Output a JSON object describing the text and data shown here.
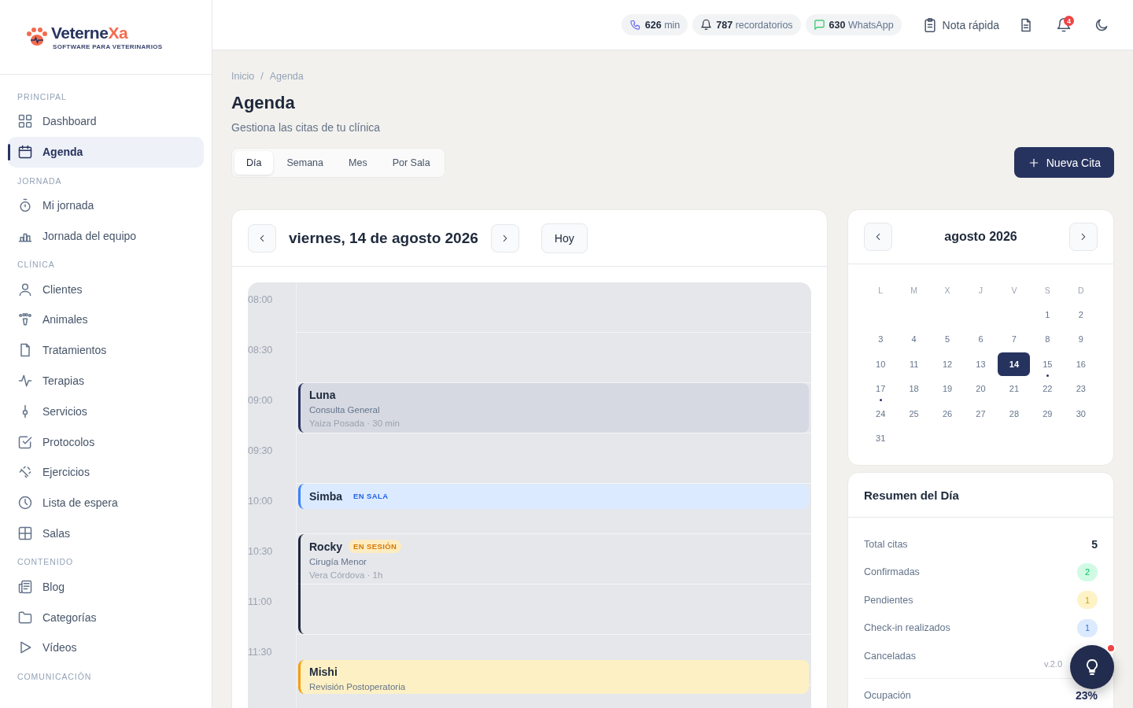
{
  "brand": {
    "name_main": "Veterne",
    "name_accent": "Xa",
    "tagline": "SOFTWARE PARA VETERINARIOS"
  },
  "topbar": {
    "chips": [
      {
        "kind": "phone",
        "value": "626",
        "label": "min"
      },
      {
        "kind": "bell",
        "value": "787",
        "label": "recordatorios"
      },
      {
        "kind": "chat",
        "value": "630",
        "label": "WhatsApp"
      }
    ],
    "quick_note": "Nota rápida",
    "notifications": "4"
  },
  "sidebar": {
    "sections": [
      {
        "title": "PRINCIPAL",
        "items": [
          {
            "label": "Dashboard",
            "selected": false
          },
          {
            "label": "Agenda",
            "selected": true
          }
        ]
      },
      {
        "title": "JORNADA",
        "items": [
          {
            "label": "Mi jornada",
            "selected": false
          },
          {
            "label": "Jornada del equipo",
            "selected": false
          }
        ]
      },
      {
        "title": "CLÍNICA",
        "items": [
          {
            "label": "Clientes",
            "selected": false
          },
          {
            "label": "Animales",
            "selected": false
          },
          {
            "label": "Tratamientos",
            "selected": false
          },
          {
            "label": "Terapias",
            "selected": false
          },
          {
            "label": "Servicios",
            "selected": false
          },
          {
            "label": "Protocolos",
            "selected": false
          },
          {
            "label": "Ejercicios",
            "selected": false
          },
          {
            "label": "Lista de espera",
            "selected": false
          },
          {
            "label": "Salas",
            "selected": false
          }
        ]
      },
      {
        "title": "CONTENIDO",
        "items": [
          {
            "label": "Blog",
            "selected": false
          },
          {
            "label": "Categorías",
            "selected": false
          },
          {
            "label": "Vídeos",
            "selected": false
          }
        ]
      },
      {
        "title": "COMUNICACIÓN"
      }
    ]
  },
  "breadcrumb": {
    "items": [
      "Inicio",
      "Agenda"
    ],
    "separator": "/"
  },
  "page": {
    "title": "Agenda",
    "subtitle": "Gestiona las citas de tu clínica"
  },
  "view_tabs": [
    {
      "label": "Día",
      "selected": true
    },
    {
      "label": "Semana",
      "selected": false
    },
    {
      "label": "Mes",
      "selected": false
    },
    {
      "label": "Por Sala",
      "selected": false
    }
  ],
  "new_button": "Nueva Cita",
  "day_view": {
    "date": "viernes, 14 de agosto 2026",
    "today_button": "Hoy",
    "slots": [
      {
        "time": "08:00"
      },
      {
        "time": "08:30"
      },
      {
        "time": "09:00",
        "appointment": {
          "kind": "done",
          "patient": "Luna",
          "service": "Consulta General",
          "detail": "Yaiza Posada · 30 min"
        }
      },
      {
        "time": "09:30"
      },
      {
        "time": "10:00",
        "appointment": {
          "kind": "in_room",
          "patient": "Simba",
          "badge": "EN SALA"
        }
      },
      {
        "time": "10:30",
        "appointment": {
          "kind": "in_session",
          "patient": "Rocky",
          "badge": "EN SESIÓN",
          "service": "Cirugía Menor",
          "detail": "Vera Córdova · 1h"
        }
      },
      {
        "time": "11:00"
      },
      {
        "time": "11:30",
        "appointment": {
          "kind": "pending",
          "patient": "Mishi",
          "service": "Revisión Postoperatoria"
        }
      }
    ]
  },
  "mini_calendar": {
    "month": "agosto 2026",
    "weekdays": [
      "L",
      "M",
      "X",
      "J",
      "V",
      "S",
      "D"
    ],
    "weeks": [
      [
        {
          "day": "1",
          "selected": false,
          "marked": false
        },
        {
          "day": "2",
          "selected": false,
          "marked": false
        }
      ],
      [
        {
          "day": "3",
          "selected": false,
          "marked": false
        },
        {
          "day": "4",
          "selected": false,
          "marked": false
        },
        {
          "day": "5",
          "selected": false,
          "marked": false
        },
        {
          "day": "6",
          "selected": false,
          "marked": false
        },
        {
          "day": "7",
          "selected": false,
          "marked": false
        },
        {
          "day": "8",
          "selected": false,
          "marked": false
        },
        {
          "day": "9",
          "selected": false,
          "marked": false
        }
      ],
      [
        {
          "day": "10",
          "selected": false,
          "marked": false
        },
        {
          "day": "11",
          "selected": false,
          "marked": false
        },
        {
          "day": "12",
          "selected": false,
          "marked": false
        },
        {
          "day": "13",
          "selected": false,
          "marked": false
        },
        {
          "day": "14",
          "selected": true,
          "marked": false
        },
        {
          "day": "15",
          "selected": false,
          "marked": true
        },
        {
          "day": "16",
          "selected": false,
          "marked": false
        }
      ],
      [
        {
          "day": "17",
          "selected": false,
          "marked": true
        },
        {
          "day": "18",
          "selected": false,
          "marked": false
        },
        {
          "day": "19",
          "selected": false,
          "marked": false
        },
        {
          "day": "20",
          "selected": false,
          "marked": false
        },
        {
          "day": "21",
          "selected": false,
          "marked": false
        },
        {
          "day": "22",
          "selected": false,
          "marked": false
        },
        {
          "day": "23",
          "selected": false,
          "marked": false
        }
      ],
      [
        {
          "day": "24",
          "selected": false,
          "marked": false
        },
        {
          "day": "25",
          "selected": false,
          "marked": false
        },
        {
          "day": "26",
          "selected": false,
          "marked": false
        },
        {
          "day": "27",
          "selected": false,
          "marked": false
        },
        {
          "day": "28",
          "selected": false,
          "marked": false
        },
        {
          "day": "29",
          "selected": false,
          "marked": false
        },
        {
          "day": "30",
          "selected": false,
          "marked": false
        }
      ],
      [
        {
          "day": "31",
          "selected": false,
          "marked": false
        }
      ]
    ]
  },
  "summary": {
    "title": "Resumen del Día",
    "rows": [
      {
        "kind": "plain",
        "label": "Total citas",
        "value": "5"
      },
      {
        "kind": "pill",
        "label": "Confirmadas",
        "value": "2",
        "color": "#d1fae5"
      },
      {
        "kind": "pill",
        "label": "Pendientes",
        "value": "1",
        "color": "#fef3c7"
      },
      {
        "kind": "pill",
        "label": "Check-in realizados",
        "value": "1",
        "color": "#dbeafe"
      },
      {
        "kind": "plain",
        "label": "Canceladas"
      },
      {
        "kind": "total",
        "label": "Ocupación",
        "value": "23%"
      }
    ]
  },
  "version": "v.2.0",
  "help_button": {
    "has_alert": true
  }
}
